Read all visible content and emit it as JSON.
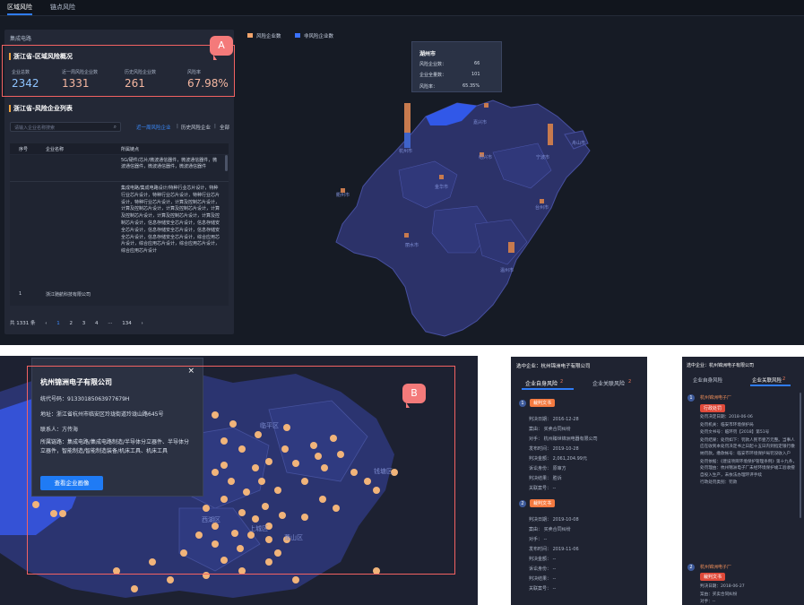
{
  "tabs": [
    "区域风险",
    "链点风险"
  ],
  "panel": {
    "industry": "集成电路",
    "overview_title": "浙江省-区域风险概况",
    "stats": [
      {
        "label": "企业总数",
        "value": "2342"
      },
      {
        "label": "近一周风险企业数",
        "value": "1331"
      },
      {
        "label": "历史风险企业数",
        "value": "261"
      },
      {
        "label": "风险率",
        "value": "67.98%"
      }
    ],
    "list_title": "浙江省-风险企业列表",
    "search_placeholder": "请输入企业名称搜索",
    "filters": [
      "近一周风险企业",
      "历史风险企业",
      "全部"
    ],
    "columns": [
      "序号",
      "企业名称",
      "所属链点"
    ],
    "row1_text": "5G/硬件/芯片/微波通信器件，微波通信器件，微波通信器件，微波通信器件，微波通信器件",
    "row2_text": "集成电路/集成电路设计/特种行业芯片设计，特种行业芯片设计，特种行业芯片设计，特种行业芯片设计，特种行业芯片设计，计算及控制芯片设计，计算及控制芯片设计，计算及控制芯片设计，计算及控制芯片设计，计算及控制芯片设计，计算及控制芯片设计，信息存储安全芯片设计，信息存储安全芯片设计，信息存储安全芯片设计，信息存储安全芯片设计，信息存储安全芯片设计，综合应用芯片设计，综合应用芯片设计，综合应用芯片设计，综合应用芯片设计",
    "row2_index": "1",
    "row2_name": "浙江驰航科技有限公司",
    "pager": {
      "total": "共 1331 条",
      "pages": [
        "1",
        "2",
        "3",
        "4",
        "···",
        "134"
      ]
    }
  },
  "legend": [
    "风险企业数",
    "非风险企业数"
  ],
  "tooltip": {
    "city": "湖州市",
    "rows": [
      [
        "风险企业数：",
        "66"
      ],
      [
        "企业全量数：",
        "101"
      ],
      [
        "风险率：",
        "65.35%"
      ]
    ]
  },
  "cities": [
    "湖州市",
    "嘉兴市",
    "杭州市",
    "绍兴市",
    "宁波市",
    "舟山市",
    "衢州市",
    "金华市",
    "台州市",
    "丽水市",
    "温州市"
  ],
  "popup": {
    "name": "杭州锦洲电子有限公司",
    "code": "统代号码：91330185063977679H",
    "address": "地址：浙江省杭州市临安区玲珑街道玲珑山路645号",
    "contact": "联系人：方传海",
    "chain": "所属链路：集成电路/集成电路制造/半导体分立器件、半导体分立器件，智能制造/智能制造装备/机床工具、机床工具",
    "button": "查看企业画像"
  },
  "districts": [
    "临平区",
    "钱塘区",
    "西湖区",
    "上城区",
    "萧山区"
  ],
  "badges": [
    "A",
    "B"
  ],
  "side1": {
    "header": "选中企业：杭州锦洲电子有限公司",
    "tabs": [
      "企业自身风险",
      "企业关联风险"
    ],
    "tab_counts": [
      "2",
      "2"
    ],
    "items": [
      {
        "tag": "裁判文书",
        "fields": [
          [
            "判决日期：",
            "2016-12-28"
          ],
          [
            "案由：",
            "买卖合同纠纷"
          ],
          [
            "对手：",
            "杭州臻世锦洲电器有限公司"
          ],
          [
            "发布时间：",
            "2019-10-28"
          ],
          [
            "判决金额：",
            "2,061,204.99元"
          ],
          [
            "诉讼身份：",
            "原审方"
          ],
          [
            "判决结果：",
            "胜诉"
          ],
          [
            "关联案号：",
            "--"
          ]
        ]
      },
      {
        "tag": "裁判文书",
        "fields": [
          [
            "判决日期：",
            "2019-10-08"
          ],
          [
            "案由：",
            "买卖合同纠纷"
          ],
          [
            "对手：",
            "--"
          ],
          [
            "发布时间：",
            "2019-11-06"
          ],
          [
            "判决金额：",
            "--"
          ],
          [
            "诉讼身份：",
            "--"
          ],
          [
            "判决结果：",
            "--"
          ],
          [
            "关联案号：",
            "--"
          ]
        ]
      }
    ]
  },
  "side2": {
    "header": "选中企业：杭州锦洲电子有限公司",
    "tabs": [
      "企业自身风险",
      "企业关联风险"
    ],
    "tab_count": "2",
    "item1_title": "杭州锦洲电子厂",
    "item1_tag": "行政处罚",
    "item1_lines": [
      "处罚决定日期：2018-06-06",
      "处罚机关：临安市环境保护局",
      "处罚文书号：临环罚【2018】第51号",
      "处罚结果：处罚如下：罚款人民币壹万元整。当事人应在收到本处罚决定书之日起十五日内到指定银行缴纳罚款。缴款帐号：临安市环境保护局罚没收入户",
      "处罚依据：《建设项目环境保护管理条例》第十九条，处罚理由：杭州锦洲电子厂未经环境保护竣工验收擅自投入生产，未依法办理环评手续",
      "行政处罚类别：罚款"
    ],
    "item2_title": "杭州锦洲电子厂",
    "item2_tag": "裁判文书",
    "item2_lines": [
      "判决日期：2018-06-27",
      "案由：买卖合同纠纷",
      "对手：--"
    ]
  }
}
